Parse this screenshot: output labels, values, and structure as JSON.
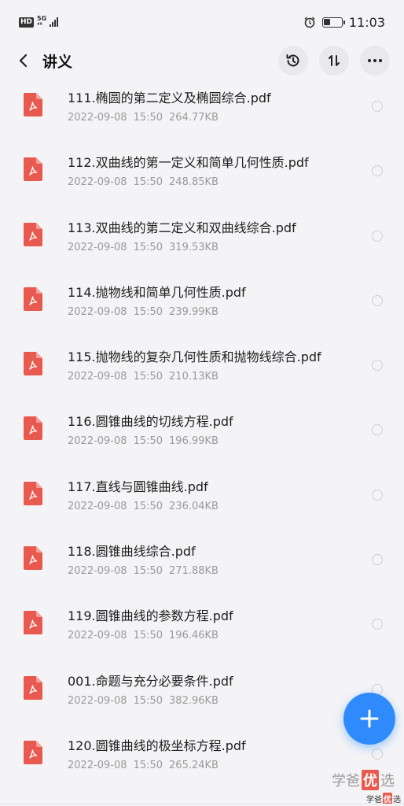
{
  "status_bar": {
    "hd": "HD",
    "net_top": "5G",
    "net_bottom": "⁴⁶",
    "time": "11:03",
    "battery_level": 0.35
  },
  "header": {
    "title": "讲义",
    "back_icon": "chevron-left-icon",
    "actions": [
      "history-icon",
      "sort-icon",
      "more-icon"
    ]
  },
  "files": [
    {
      "name": "111.椭圆的第二定义及椭圆综合.pdf",
      "date": "2022-09-08",
      "time": "15:50",
      "size": "264.77KB"
    },
    {
      "name": "112.双曲线的第一定义和简单几何性质.pdf",
      "date": "2022-09-08",
      "time": "15:50",
      "size": "248.85KB"
    },
    {
      "name": "113.双曲线的第二定义和双曲线综合.pdf",
      "date": "2022-09-08",
      "time": "15:50",
      "size": "319.53KB"
    },
    {
      "name": "114.抛物线和简单几何性质.pdf",
      "date": "2022-09-08",
      "time": "15:50",
      "size": "239.99KB"
    },
    {
      "name": "115.抛物线的复杂几何性质和抛物线综合.pdf",
      "date": "2022-09-08",
      "time": "15:50",
      "size": "210.13KB"
    },
    {
      "name": "116.圆锥曲线的切线方程.pdf",
      "date": "2022-09-08",
      "time": "15:50",
      "size": "196.99KB"
    },
    {
      "name": "117.直线与圆锥曲线.pdf",
      "date": "2022-09-08",
      "time": "15:50",
      "size": "236.04KB"
    },
    {
      "name": "118.圆锥曲线综合.pdf",
      "date": "2022-09-08",
      "time": "15:50",
      "size": "271.88KB"
    },
    {
      "name": "119.圆锥曲线的参数方程.pdf",
      "date": "2022-09-08",
      "time": "15:50",
      "size": "196.46KB"
    },
    {
      "name": "001.命题与充分必要条件.pdf",
      "date": "2022-09-08",
      "time": "15:50",
      "size": "382.96KB"
    },
    {
      "name": "120.圆锥曲线的极坐标方程.pdf",
      "date": "2022-09-08",
      "time": "15:50",
      "size": "265.24KB"
    }
  ],
  "fab": {
    "icon": "plus-icon"
  },
  "watermark": {
    "left": "学爸",
    "box": "优",
    "right": "选"
  },
  "colors": {
    "accent": "#2f8bfb",
    "pdf_red": "#e85a4f"
  }
}
